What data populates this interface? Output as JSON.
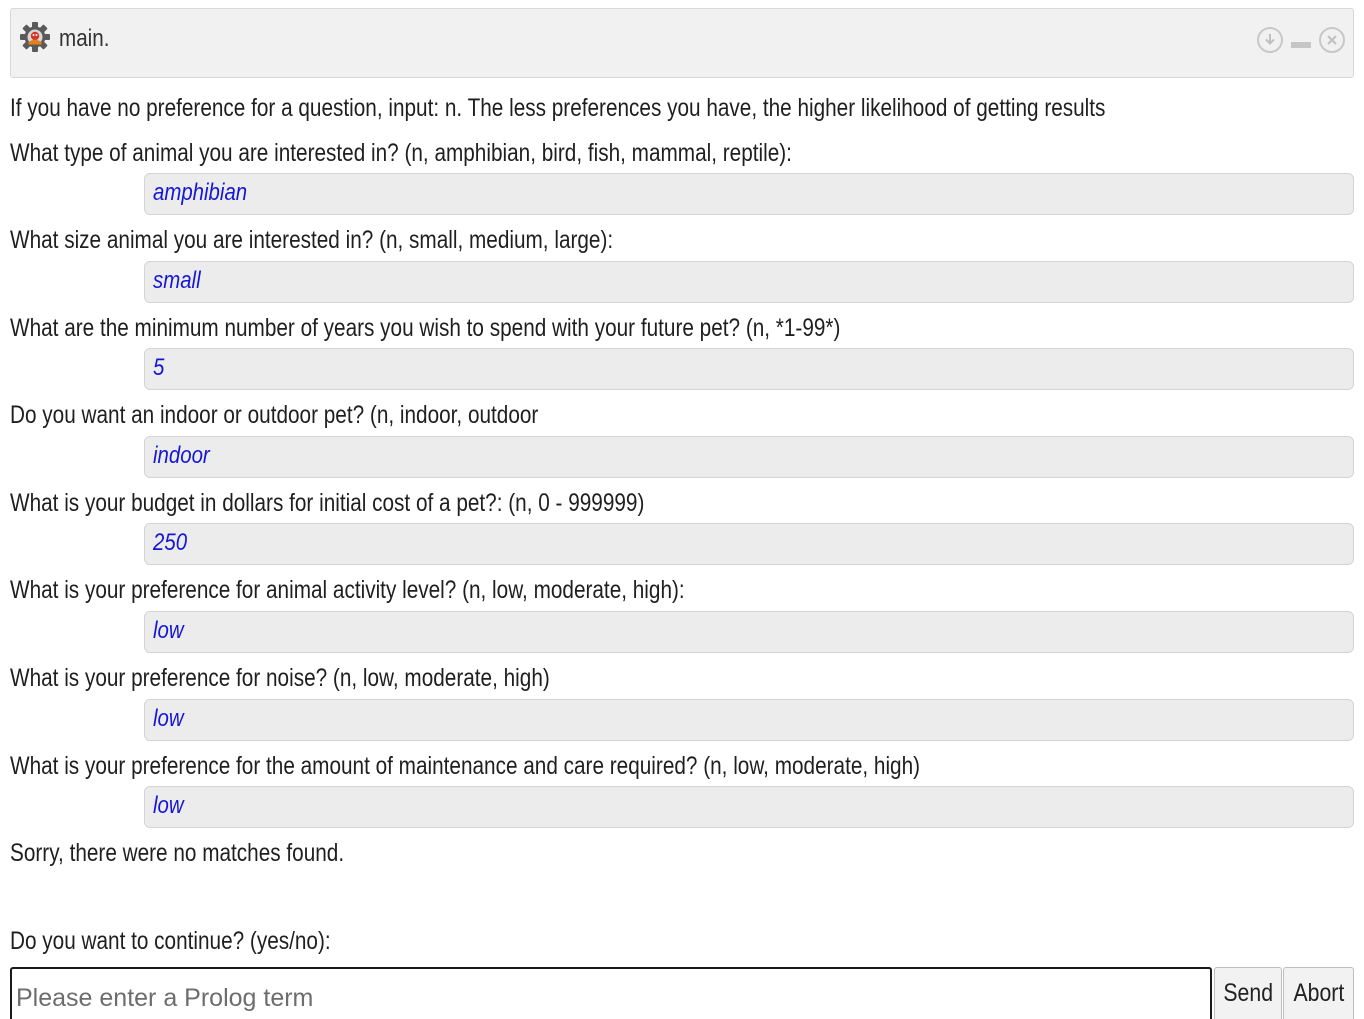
{
  "window": {
    "title": "main.",
    "icon": "gear-icon",
    "controls": [
      "download-icon",
      "minimize-icon",
      "close-icon"
    ]
  },
  "intro": "If you have no preference for a question, input: n. The less preferences you have, the higher likelihood of getting results",
  "questions": [
    {
      "prompt": "What type of animal you are interested in? (n, amphibian, bird, fish, mammal, reptile):",
      "answer": "amphibian"
    },
    {
      "prompt": "What size animal you are interested in? (n, small, medium, large):",
      "answer": "small"
    },
    {
      "prompt": "What are the minimum number of years you wish to spend with your future pet? (n, *1-99*)",
      "answer": "5"
    },
    {
      "prompt": "Do you want an indoor or outdoor pet? (n, indoor, outdoor",
      "answer": "indoor"
    },
    {
      "prompt": "What is your budget in dollars for initial cost of a pet?: (n, 0 - 999999)",
      "answer": "250"
    },
    {
      "prompt": "What is your preference for animal activity level? (n, low, moderate, high):",
      "answer": "low"
    },
    {
      "prompt": "What is your preference for noise? (n, low, moderate, high)",
      "answer": "low"
    },
    {
      "prompt": "What is your preference for the amount of maintenance and care required? (n, low, moderate, high)",
      "answer": "low"
    }
  ],
  "result": "Sorry, there were no matches found.",
  "continue_prompt": "Do you want to continue? (yes/no):",
  "input": {
    "value": "",
    "placeholder": "Please enter a Prolog term"
  },
  "buttons": {
    "send": "Send",
    "abort": "Abort"
  },
  "colors": {
    "answer_text": "#1616d6",
    "answer_bg": "#ececec",
    "titlebar_bg": "#f1f1f1"
  }
}
